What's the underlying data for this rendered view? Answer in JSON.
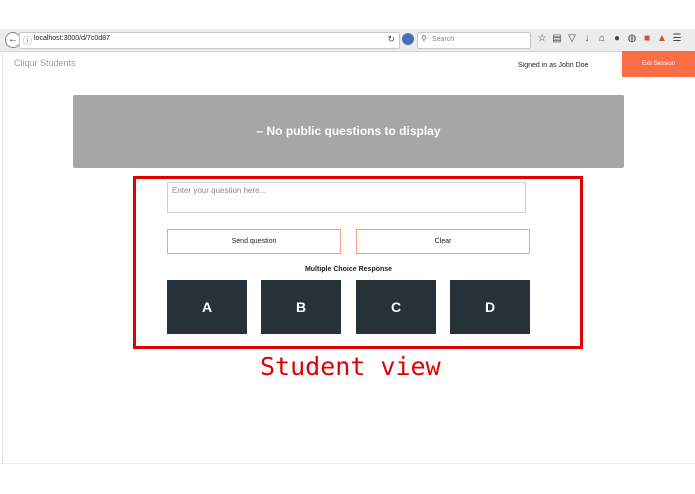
{
  "browser": {
    "url": "localhost:3000/d/7c0d87",
    "search_placeholder": "Search",
    "back_icon": "back-arrow-icon",
    "reload_icon": "reload-icon",
    "toolbar_icons": [
      "star-icon",
      "reading-list-icon",
      "pocket-icon",
      "download-icon",
      "home-icon",
      "chat-icon",
      "sync-icon",
      "extension-icon",
      "notifications-icon",
      "menu-icon"
    ]
  },
  "header": {
    "brand": "Cliqur Students",
    "signed_in": "Signed in as John Doe",
    "exit_label": "Exit Session",
    "exit_color": "#fb6d45"
  },
  "banner": {
    "text": "– No public questions to display",
    "color": "#a6a6a6"
  },
  "question": {
    "placeholder": "Enter your question here...",
    "send_label": "Send question",
    "clear_label": "Clear"
  },
  "multiple_choice": {
    "title": "Multiple Choice Response",
    "options": [
      "A",
      "B",
      "C",
      "D"
    ],
    "button_color": "#263238"
  },
  "annotation": {
    "caption": "Student view",
    "color": "#e00000"
  }
}
